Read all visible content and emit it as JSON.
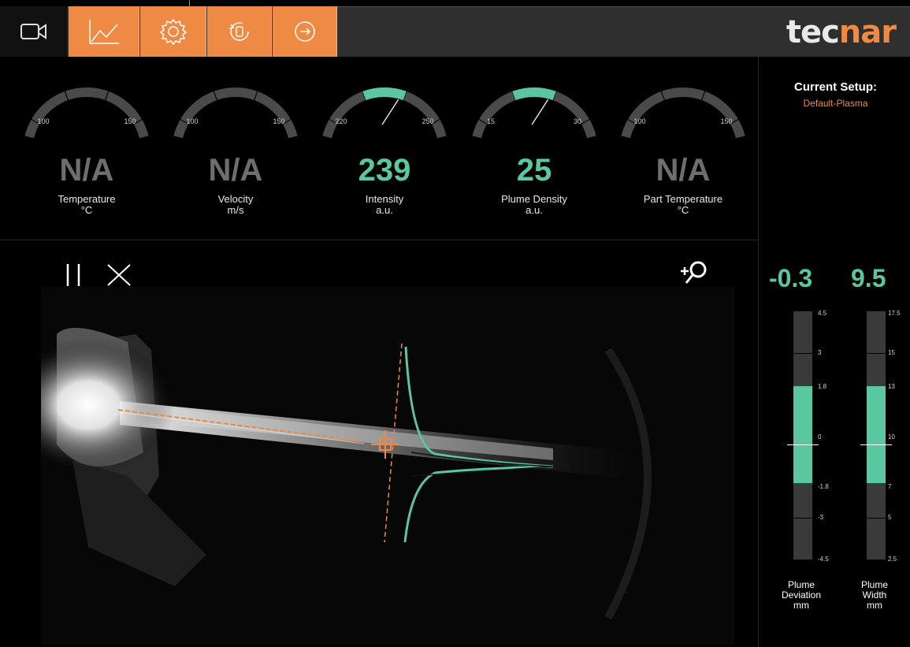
{
  "nav": {
    "tabs": [
      {
        "name": "video-camera-icon"
      },
      {
        "name": "chart-icon"
      },
      {
        "name": "gear-icon"
      },
      {
        "name": "rotate-icon"
      },
      {
        "name": "exit-icon"
      }
    ],
    "active_color": "#ee8a43"
  },
  "brand": {
    "part1": "tec",
    "part2": "nar"
  },
  "gauges": [
    {
      "value": "N/A",
      "label": "Temperature",
      "unit": "°C",
      "min_tick": "100",
      "max_tick": "150",
      "active": false
    },
    {
      "value": "N/A",
      "label": "Velocity",
      "unit": "m/s",
      "min_tick": "100",
      "max_tick": "150",
      "active": false
    },
    {
      "value": "239",
      "label": "Intensity",
      "unit": "a.u.",
      "min_tick": "220",
      "max_tick": "250",
      "active": true
    },
    {
      "value": "25",
      "label": "Plume Density",
      "unit": "a.u.",
      "min_tick": "15",
      "max_tick": "30",
      "active": true
    },
    {
      "value": "N/A",
      "label": "Part Temperature",
      "unit": "°C",
      "min_tick": "100",
      "max_tick": "150",
      "active": false
    }
  ],
  "setup": {
    "heading": "Current Setup:",
    "name": "Default-Plasma"
  },
  "video": {
    "pause_icon": "pause-icon",
    "close_icon": "close-icon",
    "zoom_icon": "zoom-in-icon"
  },
  "meters": [
    {
      "value": "-0.3",
      "label1": "Plume",
      "label2": "Deviation",
      "unit": "mm",
      "ticks": [
        "4.5",
        "3",
        "1.8",
        "0",
        "-1.8",
        "-3",
        "-4.5"
      ]
    },
    {
      "value": "9.5",
      "label1": "Plume",
      "label2": "Width",
      "unit": "mm",
      "ticks": [
        "17.5",
        "15",
        "13",
        "10",
        "7",
        "5",
        "2.5"
      ]
    }
  ],
  "colors": {
    "accent": "#5bc7a1",
    "orange": "#ee8a43"
  }
}
